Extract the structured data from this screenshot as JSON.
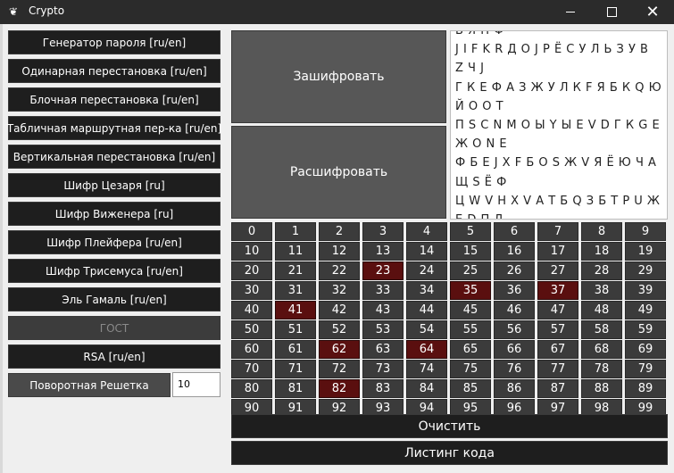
{
  "window": {
    "title": "Crypto",
    "app_icon": "bird-icon",
    "controls": {
      "minimize": "minimize-icon",
      "maximize": "maximize-icon",
      "close": "close-icon"
    }
  },
  "sidebar": {
    "items": [
      {
        "label": "Генератор пароля [ru/en]"
      },
      {
        "label": "Одинарная перестановка [ru/en]"
      },
      {
        "label": "Блочная перестановка [ru/en]"
      },
      {
        "label": "Табличная маршрутная пер-ка [ru/en]"
      },
      {
        "label": "Вертикальная перестановка [ru/en]"
      },
      {
        "label": "Шифр Цезаря [ru]"
      },
      {
        "label": "Шифр Виженера [ru]"
      },
      {
        "label": "Шифр Плейфера [ru/en]"
      },
      {
        "label": "Шифр Трисемуса [ru/en]"
      },
      {
        "label": "Эль Гамаль [ru/en]"
      },
      {
        "label": "ГОСТ",
        "disabled": true
      },
      {
        "label": "RSA [ru/en]"
      }
    ],
    "grille": {
      "label": "Поворотная Решетка",
      "value": "10"
    }
  },
  "actions": {
    "encrypt_label": "Зашифровать",
    "decrypt_label": "Расшифровать",
    "clear_label": "Очистить",
    "listing_label": "Листинг кода"
  },
  "output": {
    "lines": [
      "В Я Н Ф",
      "J I F K R Д О J Р Ё С У Л Ь З У В",
      "Z Ч J",
      "Г К Е Ф А З Ж У Л К F Я Б К Q Ю",
      "Й О О Т",
      "П S C N М О Ы Y Ы Е V D Г К G E",
      "Ж О N E",
      "Ф Б Е J X F Б О S Ж V Я Ё Ю Ч А",
      "Щ S Ё Ф",
      "Ц W V H X V А Т Б Q З Б Т Р U Ж",
      "E D П Д"
    ]
  },
  "number_grid": {
    "header": [
      "0",
      "1",
      "2",
      "3",
      "4",
      "5",
      "6",
      "7",
      "8",
      "9"
    ],
    "highlighted": [
      23,
      35,
      37,
      41,
      62,
      64,
      82
    ],
    "highlight_color": "#5a0f0f"
  }
}
